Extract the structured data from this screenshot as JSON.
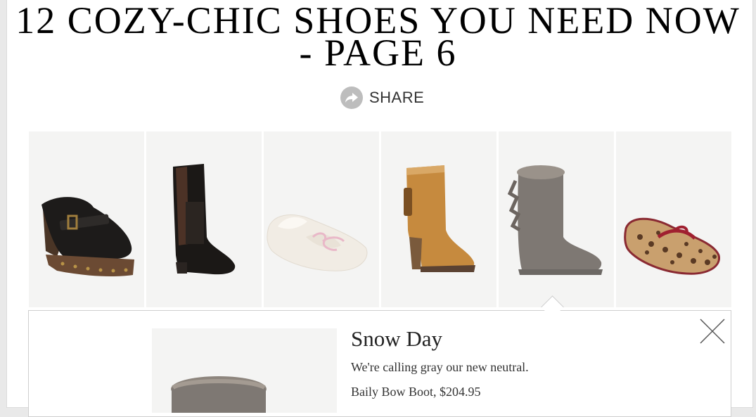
{
  "article": {
    "title_line1": "12 COZY-CHIC SHOES YOU NEED NOW",
    "title_line2": "- PAGE 6"
  },
  "share": {
    "label": "SHARE"
  },
  "thumbnails": [
    {
      "name": "black-leather-clog"
    },
    {
      "name": "black-tall-boot"
    },
    {
      "name": "cream-moccasin-slipper"
    },
    {
      "name": "tan-suede-heeled-boot"
    },
    {
      "name": "gray-bailey-bow-boot",
      "selected": true
    },
    {
      "name": "leopard-print-moccasin"
    }
  ],
  "detail": {
    "title": "Snow Day",
    "description": "We're calling gray our new neutral.",
    "product": "Baily Bow Boot, $204.95"
  }
}
